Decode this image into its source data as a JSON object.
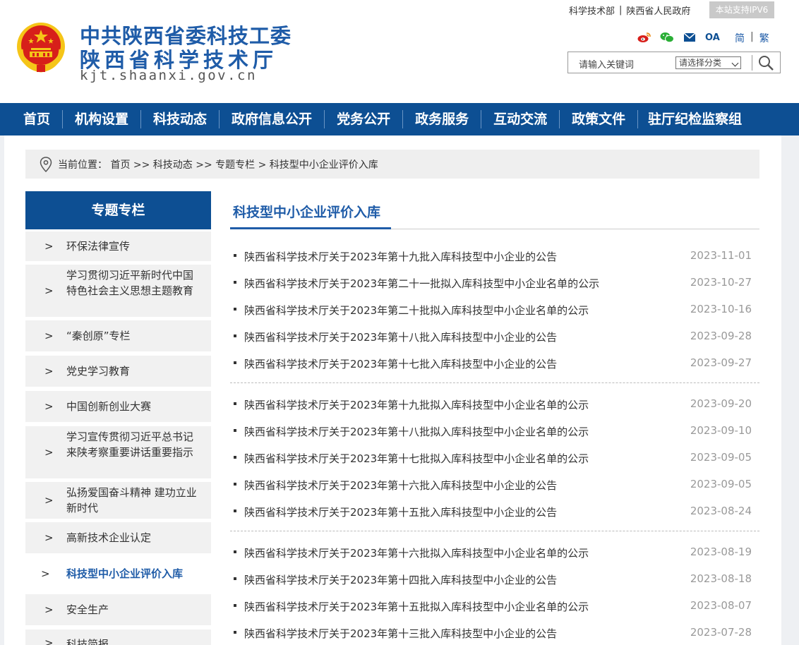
{
  "header": {
    "title_line1": "中共陕西省委科技工委",
    "title_line2": "陕西省科学技术厅",
    "site_url": "kjt.shaanxi.gov.cn",
    "top_links": [
      "科学技术部",
      "陕西省人民政府"
    ],
    "ipv6_badge": "本站支持IPV6",
    "lang_simplified": "简",
    "lang_traditional": "繁",
    "social_oa": "OA",
    "search_placeholder": "请输入关键词",
    "search_category": "请选择分类"
  },
  "nav": [
    "首页",
    "机构设置",
    "科技动态",
    "政府信息公开",
    "党务公开",
    "政务服务",
    "互动交流",
    "政策文件",
    "驻厅纪检监察组"
  ],
  "breadcrumb": "当前位置： 首页 >> 科技动态 >> 专题专栏 > 科技型中小企业评价入库",
  "sidebar": {
    "heading": "专题专栏",
    "chevron": ">",
    "items": [
      "环保法律宣传",
      "学习贯彻习近平新时代中国特色社会主义思想主题教育",
      "“秦创原”专栏",
      "党史学习教育",
      "中国创新创业大赛",
      "学习宣传贯彻习近平总书记来陕考察重要讲话重要指示",
      "弘扬爱国奋斗精神 建功立业新时代",
      "高新技术企业认定",
      "科技型中小企业评价入库",
      "安全生产",
      "科技简报"
    ]
  },
  "content": {
    "title": "科技型中小企业评价入库",
    "articles": [
      {
        "title": "陕西省科学技术厅关于2023年第十九批入库科技型中小企业的公告",
        "date": "2023-11-01"
      },
      {
        "title": "陕西省科学技术厅关于2023年第二十一批拟入库科技型中小企业名单的公示",
        "date": "2023-10-27"
      },
      {
        "title": "陕西省科学技术厅关于2023年第二十批拟入库科技型中小企业名单的公示",
        "date": "2023-10-16"
      },
      {
        "title": "陕西省科学技术厅关于2023年第十八批入库科技型中小企业的公告",
        "date": "2023-09-28"
      },
      {
        "title": "陕西省科学技术厅关于2023年第十七批入库科技型中小企业的公告",
        "date": "2023-09-27"
      },
      {
        "title": "陕西省科学技术厅关于2023年第十九批拟入库科技型中小企业名单的公示",
        "date": "2023-09-20"
      },
      {
        "title": "陕西省科学技术厅关于2023年第十八批拟入库科技型中小企业名单的公示",
        "date": "2023-09-10"
      },
      {
        "title": "陕西省科学技术厅关于2023年第十七批拟入库科技型中小企业名单的公示",
        "date": "2023-09-05"
      },
      {
        "title": "陕西省科学技术厅关于2023年第十六批入库科技型中小企业的公告",
        "date": "2023-09-05"
      },
      {
        "title": "陕西省科学技术厅关于2023年第十五批入库科技型中小企业的公告",
        "date": "2023-08-24"
      },
      {
        "title": "陕西省科学技术厅关于2023年第十六批拟入库科技型中小企业名单的公示",
        "date": "2023-08-19"
      },
      {
        "title": "陕西省科学技术厅关于2023年第十四批入库科技型中小企业的公告",
        "date": "2023-08-18"
      },
      {
        "title": "陕西省科学技术厅关于2023年第十五批拟入库科技型中小企业名单的公示",
        "date": "2023-08-07"
      },
      {
        "title": "陕西省科学技术厅关于2023年第十三批入库科技型中小企业的公告",
        "date": "2023-07-28"
      }
    ]
  },
  "colors": {
    "brand_blue": "#0d4f93",
    "title_blue": "#1f5ca8",
    "emblem_red": "#d71f1a",
    "emblem_gold": "#f5c518"
  }
}
